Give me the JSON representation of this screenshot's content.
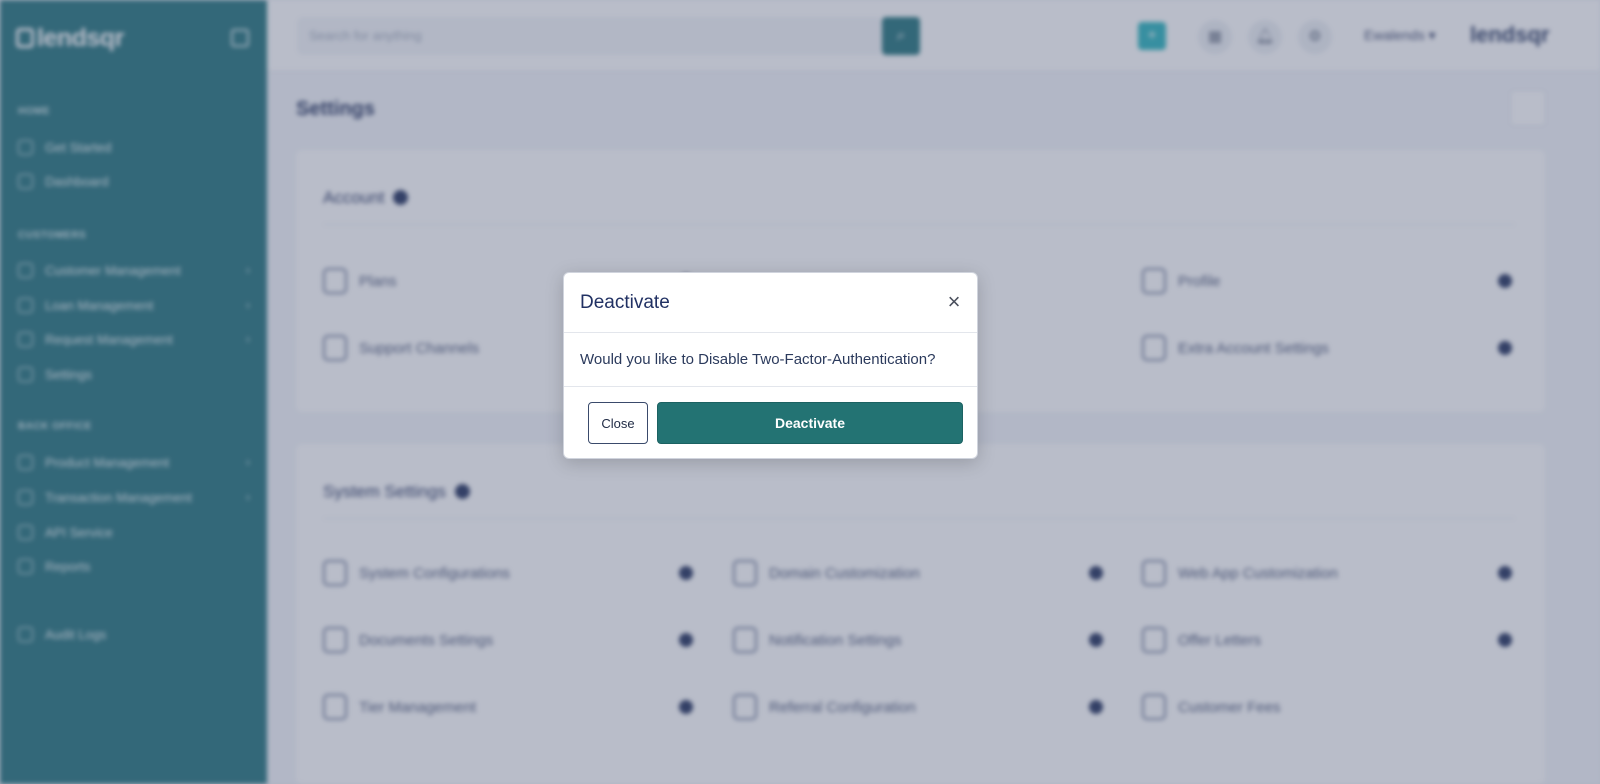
{
  "sidebar": {
    "logo": "lendsqr",
    "sections": {
      "home": "HOME",
      "customers": "CUSTOMERS",
      "back_office": "BACK OFFICE"
    },
    "items": {
      "get_started": "Get Started",
      "dashboard": "Dashboard",
      "customer_management": "Customer Management",
      "loan_management": "Loan Management",
      "request_management": "Request Management",
      "settings": "Settings",
      "product_management": "Product Management",
      "transaction_management": "Transaction Management",
      "api_service": "API Service",
      "reports": "Reports",
      "audit_logs": "Audit Logs"
    }
  },
  "topbar": {
    "search_placeholder": "Search for anything",
    "user_name": "Ewalends",
    "brand_logo": "lendsqr"
  },
  "main": {
    "page_title": "Settings",
    "account_card": {
      "title": "Account",
      "items": {
        "plans": "Plans",
        "profile": "Profile",
        "support_channels": "Support Channels",
        "extra_account_settings": "Extra Account Settings"
      }
    },
    "system_card": {
      "title": "System Settings",
      "items": {
        "system_configurations": "System Configurations",
        "domain_customization": "Domain Customization",
        "web_app_customization": "Web App Customization",
        "documents_settings": "Documents Settings",
        "notification_settings": "Notification Settings",
        "offer_letters": "Offer Letters",
        "tier_management": "Tier Management",
        "referral_configuration": "Referral Configuration",
        "customer_fees": "Customer Fees"
      }
    }
  },
  "modal": {
    "title": "Deactivate",
    "close_glyph": "×",
    "message": "Would you like to Disable Two-Factor-Authentication?",
    "close_label": "Close",
    "confirm_label": "Deactivate"
  },
  "colors": {
    "brand": "#2e7a82",
    "primary_button": "#237373",
    "overlay": "#3c4869"
  }
}
